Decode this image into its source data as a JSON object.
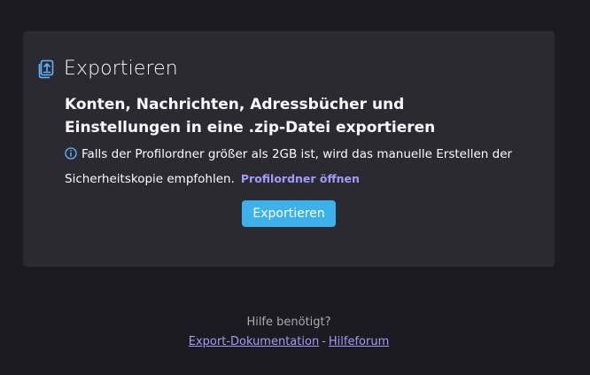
{
  "card": {
    "title": "Exportieren",
    "icon": "export-document-icon",
    "headline": "Konten, Nachrichten, Adressbücher und Einstellungen in eine .zip-Datei exportieren",
    "note_icon": "info-icon",
    "note_text": "Falls der Profilordner größer als 2GB ist, wird das manuelle Erstellen der Sicherheitskopie empfohlen.",
    "open_profile_link": "Profilordner öffnen",
    "export_button": "Exportieren"
  },
  "help": {
    "question": "Hilfe benötigt?",
    "docs_link": "Export-Dokumentation",
    "separator": "-",
    "forum_link": "Hilfeforum"
  },
  "colors": {
    "background": "#1c1b22",
    "card": "#2b2a33",
    "accent_button": "#3db1ea",
    "link": "#a29bf6",
    "muted_text": "#a9a9b3"
  }
}
